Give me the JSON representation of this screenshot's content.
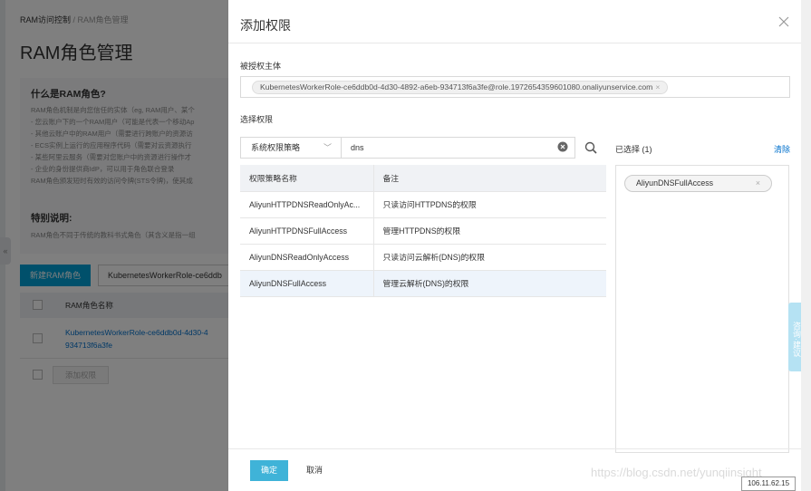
{
  "background_page": {
    "breadcrumb": {
      "root": "RAM访问控制",
      "separator": "/",
      "current": "RAM角色管理"
    },
    "title": "RAM角色管理",
    "info": {
      "heading": "什么是RAM角色?",
      "lines": [
        "RAM角色机制是向您信任的实体（eg, RAM用户、某个",
        "- 您云账户下的一个RAM用户（可能是代表一个移动Ap",
        "- 其他云账户中的RAM用户（需要进行跨账户的资源访",
        "- ECS实例上运行的应用程序代码（需要对云资源执行",
        "- 某些阿里云服务（需要对您账户中的资源进行操作才",
        "- 企业的身份提供商IdP，可以用于角色联合登录",
        "RAM角色颁发短时有效的访问令牌(STS令牌)，使其成"
      ],
      "special_heading": "特别说明:",
      "special_line": "RAM角色不同于传统的教科书式角色（其含义是指一组"
    },
    "create_button": "新建RAM角色",
    "search_value": "KubernetesWorkerRole-ce6ddb",
    "table_header": "RAM角色名称",
    "row_name_line1": "KubernetesWorkerRole-ce6ddb0d-4d30-4",
    "row_name_line2": "934713f6a3fe",
    "footer_button": "添加权限",
    "collapse_glyph": "«"
  },
  "drawer": {
    "title": "添加权限",
    "principal_label": "被授权主体",
    "principal_tag": "KubernetesWorkerRole-ce6ddb0d-4d30-4892-a6eb-934713f6a3fe@role.1972654359601080.onaliyunservice.com",
    "select_label": "选择权限",
    "policy_type": "系统权限策略",
    "search_value": "dns",
    "selected_label": "已选择 (1)",
    "clear_label": "清除",
    "table": {
      "headers": [
        "权限策略名称",
        "备注"
      ],
      "rows": [
        {
          "name": "AliyunHTTPDNSReadOnlyAc...",
          "note": "只读访问HTTPDNS的权限"
        },
        {
          "name": "AliyunHTTPDNSFullAccess",
          "note": "管理HTTPDNS的权限"
        },
        {
          "name": "AliyunDNSReadOnlyAccess",
          "note": "只读访问云解析(DNS)的权限"
        },
        {
          "name": "AliyunDNSFullAccess",
          "note": "管理云解析(DNS)的权限"
        }
      ]
    },
    "selected_items": [
      "AliyunDNSFullAccess"
    ],
    "ok_button": "确定",
    "cancel_button": "取消"
  },
  "side_tab": "咨询·建议",
  "watermark": "https://blog.csdn.net/yunqiinsight",
  "ip_label": "106.11.62.15",
  "colors": {
    "primary": "#00a1d6",
    "link": "#0070cc",
    "ok_button": "#3fb3d8",
    "row_highlight": "#eef4fb"
  }
}
